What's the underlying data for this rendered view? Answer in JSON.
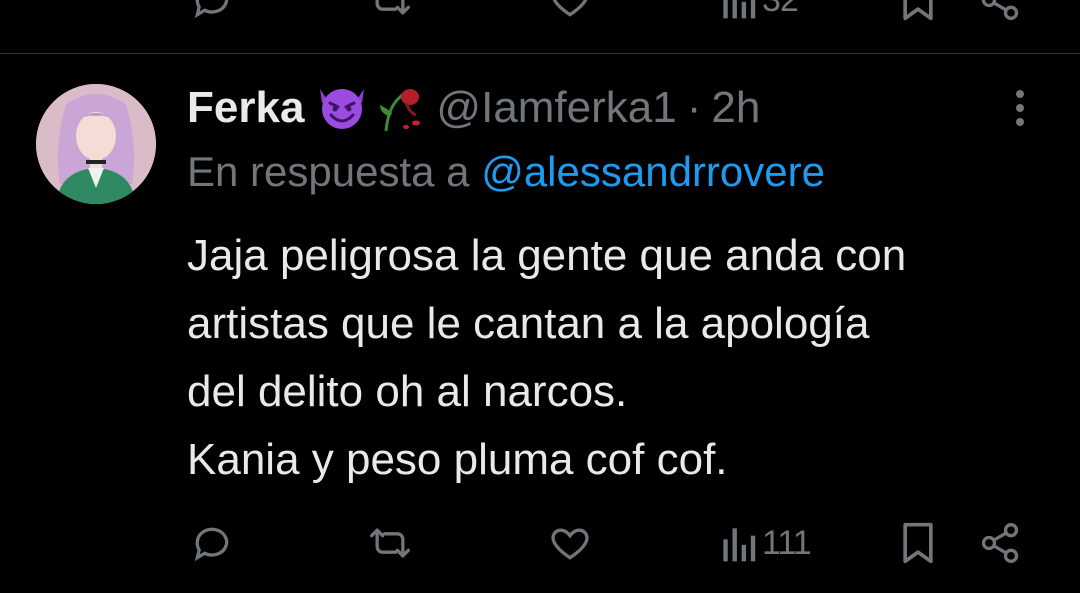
{
  "previous_tweet": {
    "views_count": "32"
  },
  "tweet": {
    "author_name": "Ferka",
    "author_handle": "@Iamferka1",
    "separator": "·",
    "time": "2h",
    "author_emojis": [
      "smiling-imp-emoji",
      "wilted-rose-emoji"
    ],
    "reply_prefix": "En respuesta a",
    "reply_handle": "@alessandrrovere",
    "text_lines": [
      "Jaja peligrosa la gente que anda con",
      "artistas que le cantan a la apología",
      "del delito oh al narcos.",
      "Kania y peso pluma cof cof."
    ],
    "views_count": "111"
  },
  "colors": {
    "background": "#000000",
    "text_primary": "#e7e9ea",
    "text_secondary": "#71767b",
    "link": "#1d9bf0",
    "divider": "#2f3336"
  },
  "icons": [
    "reply-icon",
    "retweet-icon",
    "like-icon",
    "views-icon",
    "bookmark-icon",
    "share-icon",
    "more-icon"
  ]
}
